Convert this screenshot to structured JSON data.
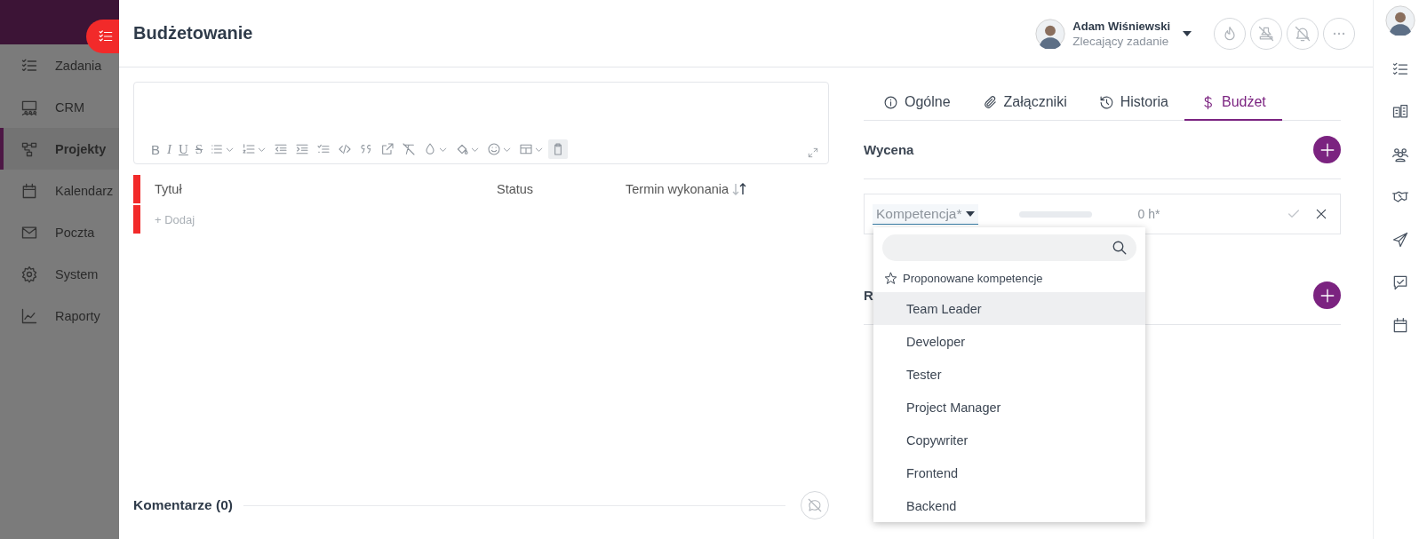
{
  "sidebar": {
    "items": [
      {
        "label": "Zadania",
        "selected": false
      },
      {
        "label": "CRM",
        "selected": false
      },
      {
        "label": "Projekty",
        "selected": true
      },
      {
        "label": "Kalendarz",
        "selected": false
      },
      {
        "label": "Poczta",
        "selected": false
      },
      {
        "label": "System",
        "selected": false
      },
      {
        "label": "Raporty",
        "selected": false
      }
    ]
  },
  "header": {
    "title": "Budżetowanie",
    "user": {
      "name": "Adam Wiśniewski",
      "role": "Zlecający zadanie"
    }
  },
  "editor": {
    "toolbar": [
      {
        "label": "B",
        "selected": false
      },
      {
        "label": "I",
        "selected": false
      },
      {
        "label": "U",
        "selected": false
      },
      {
        "label": "S",
        "selected": false
      },
      {
        "selected": false
      },
      {
        "selected": false
      },
      {
        "selected": false
      },
      {
        "selected": false
      },
      {
        "selected": false
      },
      {
        "selected": false
      },
      {
        "selected": false
      },
      {
        "selected": false
      },
      {
        "selected": false
      },
      {
        "selected": false
      },
      {
        "selected": false
      },
      {
        "selected": false
      },
      {
        "selected": false
      },
      {
        "selected": true
      }
    ]
  },
  "tasks": {
    "columns": [
      "Tytuł",
      "Status",
      "Termin wykonania"
    ],
    "add": "+ Dodaj"
  },
  "comments": {
    "title": "Komentarze (0)"
  },
  "tabs": [
    {
      "label": "Ogólne",
      "selected": false
    },
    {
      "label": "Załączniki",
      "selected": false
    },
    {
      "label": "Historia",
      "selected": false
    },
    {
      "label": "Budżet",
      "selected": true
    }
  ],
  "sections": [
    {
      "title": "Wycena"
    },
    {
      "title": "R"
    }
  ],
  "estimate_row": {
    "competence": "Kompetencja*",
    "hours": "0 h*"
  },
  "dropdown": {
    "group": "Proponowane kompetencje",
    "options": [
      {
        "label": "Team Leader",
        "selected": true
      },
      {
        "label": "Developer",
        "selected": false
      },
      {
        "label": "Tester",
        "selected": false
      },
      {
        "label": "Project Manager",
        "selected": false
      },
      {
        "label": "Copywriter",
        "selected": false
      },
      {
        "label": "Frontend",
        "selected": false
      },
      {
        "label": "Backend",
        "selected": false
      }
    ]
  }
}
